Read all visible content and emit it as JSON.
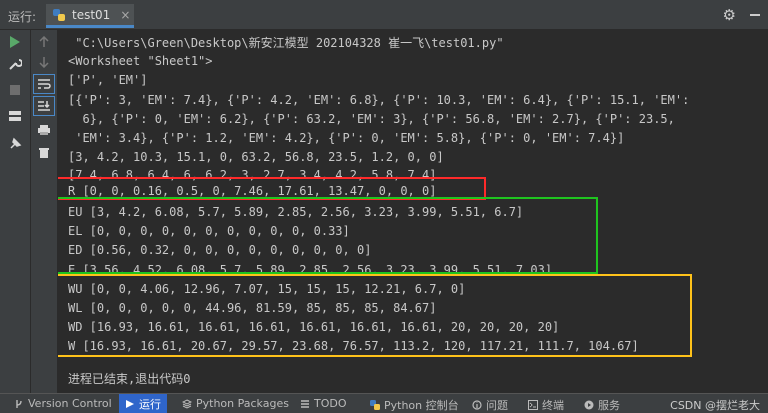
{
  "window": {
    "run_label": "运行:",
    "tab_label": "test01",
    "tab_close": "×"
  },
  "console": {
    "lines": [
      " \"C:\\Users\\Green\\Desktop\\新安江模型 202104328 崔一飞\\test01.py\"",
      "<Worksheet \"Sheet1\">",
      "['P', 'EM']",
      "[{'P': 3, 'EM': 7.4}, {'P': 4.2, 'EM': 6.8}, {'P': 10.3, 'EM': 6.4}, {'P': 15.1, 'EM':",
      "  6}, {'P': 0, 'EM': 6.2}, {'P': 63.2, 'EM': 3}, {'P': 56.8, 'EM': 2.7}, {'P': 23.5,",
      " 'EM': 3.4}, {'P': 1.2, 'EM': 4.2}, {'P': 0, 'EM': 5.8}, {'P': 0, 'EM': 7.4}]",
      "[3, 4.2, 10.3, 15.1, 0, 63.2, 56.8, 23.5, 1.2, 0, 0]",
      "[7.4, 6.8, 6.4, 6, 6.2, 3, 2.7, 3.4, 4.2, 5.8, 7.4]",
      "R [0, 0, 0.16, 0.5, 0, 7.46, 17.61, 13.47, 0, 0, 0]",
      "EU [3, 4.2, 6.08, 5.7, 5.89, 2.85, 2.56, 3.23, 3.99, 5.51, 6.7]",
      "EL [0, 0, 0, 0, 0, 0, 0, 0, 0, 0, 0.33]",
      "ED [0.56, 0.32, 0, 0, 0, 0, 0, 0, 0, 0, 0]",
      "E [3.56, 4.52, 6.08, 5.7, 5.89, 2.85, 2.56, 3.23, 3.99, 5.51, 7.03]",
      "WU [0, 0, 4.06, 12.96, 7.07, 15, 15, 15, 12.21, 6.7, 0]",
      "WL [0, 0, 0, 0, 0, 44.96, 81.59, 85, 85, 85, 84.67]",
      "WD [16.93, 16.61, 16.61, 16.61, 16.61, 16.61, 16.61, 20, 20, 20, 20]",
      "W [16.93, 16.61, 20.67, 29.57, 23.68, 76.57, 113.2, 120, 117.21, 111.7, 104.67]",
      "",
      "进程已结束,退出代码0"
    ],
    "highlight_colors": {
      "red": "#ff2a2a",
      "green": "#1fc41f",
      "yellow": "#ffc21a"
    }
  },
  "statusbar": {
    "items": [
      {
        "label": "Version Control",
        "icon": "branch-icon"
      },
      {
        "label": "运行",
        "icon": "play-icon",
        "active": true
      },
      {
        "label": "Python Packages",
        "icon": "layers-icon"
      },
      {
        "label": "TODO",
        "icon": "list-icon"
      },
      {
        "label": "Python 控制台",
        "icon": "python-icon"
      },
      {
        "label": "问题",
        "icon": "info-icon"
      },
      {
        "label": "终端",
        "icon": "terminal-icon"
      },
      {
        "label": "服务",
        "icon": "play-circle-icon"
      }
    ],
    "watermark": "CSDN @摆烂老大"
  },
  "colors": {
    "accent": "#2f65ca",
    "run_green": "#59a869"
  }
}
